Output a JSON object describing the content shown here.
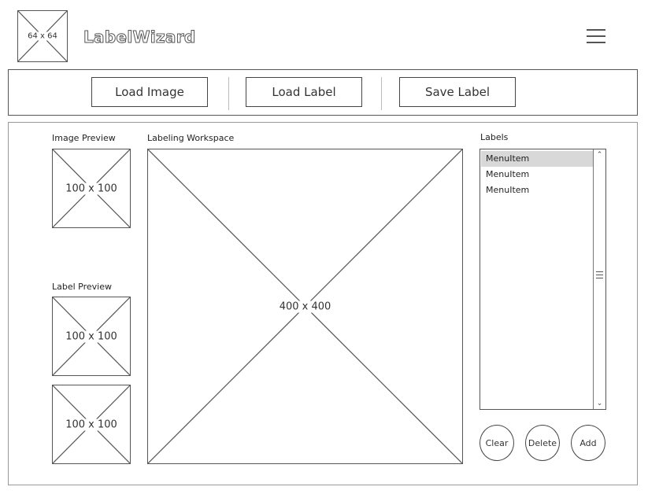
{
  "header": {
    "logo_dims": "64 x 64",
    "app_title": "LabelWizard"
  },
  "toolbar": {
    "load_image_label": "Load Image",
    "load_label_label": "Load Label",
    "save_label_label": "Save Label"
  },
  "image_preview": {
    "heading": "Image Preview",
    "dims": "100 x 100"
  },
  "workspace": {
    "heading": "Labeling Workspace",
    "dims": "400 x 400"
  },
  "label_preview": {
    "heading": "Label Preview",
    "first_dims": "100 x 100",
    "second_dims": "100 x 100"
  },
  "labels_panel": {
    "heading": "Labels",
    "items": [
      "MenuItem",
      "MenuItem",
      "MenuItem"
    ],
    "selected_index": 0,
    "clear_label": "Clear",
    "delete_label": "Delete",
    "add_label": "Add"
  }
}
